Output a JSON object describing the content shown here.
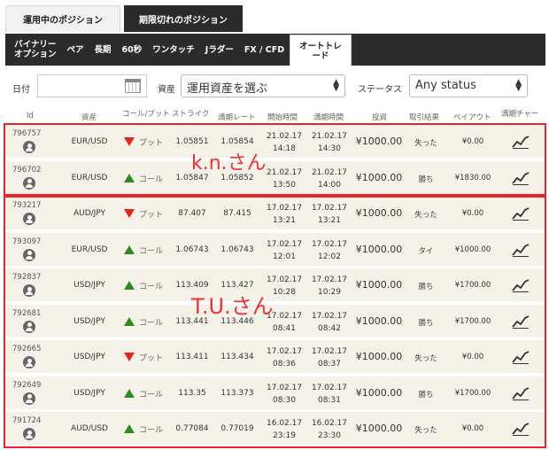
{
  "top_tabs": [
    {
      "label": "運用中のポジション"
    },
    {
      "label": "期限切れのポジション"
    }
  ],
  "subnav": [
    {
      "label": "バイナリー\nオプション"
    },
    {
      "label": "ペア"
    },
    {
      "label": "長期"
    },
    {
      "label": "60秒"
    },
    {
      "label": "ワンタッチ"
    },
    {
      "label": "Jラダー"
    },
    {
      "label": "FX / CFD"
    },
    {
      "label": "オートトレ\nード"
    }
  ],
  "filters": {
    "date_label": "日付",
    "date_value": "",
    "asset_label": "資産",
    "asset_value": "運用資産を選ぶ",
    "status_label": "ステータス",
    "status_value": "Any status"
  },
  "columns": {
    "id": "Id",
    "asset": "資産",
    "direction": "コール/プット",
    "strike": "ストライク",
    "expiry_rate": "満期レート",
    "start": "開始時間",
    "end": "満期時間",
    "invest": "投資",
    "result": "取引結果",
    "payout": "ペイアウト",
    "chart": "満期チャー"
  },
  "rows": [
    {
      "id": "796757",
      "asset": "EUR/USD",
      "direction": "プット",
      "dir": "down",
      "strike": "1.05851",
      "expiry": "1.05854",
      "start_date": "21.02.17",
      "start_time": "14:18",
      "end_date": "21.02.17",
      "end_time": "14:30",
      "invest": "¥1000.00",
      "result": "失った",
      "payout": "¥0.00"
    },
    {
      "id": "796702",
      "asset": "EUR/USD",
      "direction": "コール",
      "dir": "up",
      "strike": "1.05847",
      "expiry": "1.05852",
      "start_date": "21.02.17",
      "start_time": "13:50",
      "end_date": "21.02.17",
      "end_time": "14:00",
      "invest": "¥1000.00",
      "result": "勝ち",
      "payout": "¥1830.00"
    },
    {
      "id": "793217",
      "asset": "AUD/JPY",
      "direction": "プット",
      "dir": "down",
      "strike": "87.407",
      "expiry": "87.415",
      "start_date": "17.02.17",
      "start_time": "13:21",
      "end_date": "17.02.17",
      "end_time": "13:21",
      "invest": "¥1000.00",
      "result": "失った",
      "payout": "¥0.00"
    },
    {
      "id": "793097",
      "asset": "EUR/USD",
      "direction": "コール",
      "dir": "up",
      "strike": "1.06743",
      "expiry": "1.06743",
      "start_date": "17.02.17",
      "start_time": "12:01",
      "end_date": "17.02.17",
      "end_time": "12:02",
      "invest": "¥1000.00",
      "result": "タイ",
      "payout": "¥1000.00"
    },
    {
      "id": "792837",
      "asset": "USD/JPY",
      "direction": "コール",
      "dir": "up",
      "strike": "113.409",
      "expiry": "113.427",
      "start_date": "17.02.17",
      "start_time": "10:28",
      "end_date": "17.02.17",
      "end_time": "10:29",
      "invest": "¥1000.00",
      "result": "勝ち",
      "payout": "¥1700.00"
    },
    {
      "id": "792681",
      "asset": "USD/JPY",
      "direction": "コール",
      "dir": "up",
      "strike": "113.441",
      "expiry": "113.446",
      "start_date": "17.02.17",
      "start_time": "08:41",
      "end_date": "17.02.17",
      "end_time": "08:42",
      "invest": "¥1000.00",
      "result": "勝ち",
      "payout": "¥1700.00"
    },
    {
      "id": "792665",
      "asset": "USD/JPY",
      "direction": "プット",
      "dir": "down",
      "strike": "113.411",
      "expiry": "113.434",
      "start_date": "17.02.17",
      "start_time": "08:36",
      "end_date": "17.02.17",
      "end_time": "08:37",
      "invest": "¥1000.00",
      "result": "失った",
      "payout": "¥0.00"
    },
    {
      "id": "792649",
      "asset": "USD/JPY",
      "direction": "コール",
      "dir": "up",
      "strike": "113.35",
      "expiry": "113.373",
      "start_date": "17.02.17",
      "start_time": "08:30",
      "end_date": "17.02.17",
      "end_time": "08:31",
      "invest": "¥1000.00",
      "result": "勝ち",
      "payout": "¥1700.00"
    },
    {
      "id": "791724",
      "asset": "AUD/USD",
      "direction": "コール",
      "dir": "up",
      "strike": "0.77084",
      "expiry": "0.77019",
      "start_date": "16.02.17",
      "start_time": "23:19",
      "end_date": "16.02.17",
      "end_time": "23:30",
      "invest": "¥1000.00",
      "result": "失った",
      "payout": "¥0.00"
    }
  ],
  "annotations": {
    "group1": "k.n.さん",
    "group2": "T.U.さん"
  },
  "colors": {
    "dark_bar": "#2b2b2b",
    "row_bg": "#f3f1e8",
    "call": "#2e8b1f",
    "put": "#e3261c",
    "highlight": "#e8252a"
  }
}
